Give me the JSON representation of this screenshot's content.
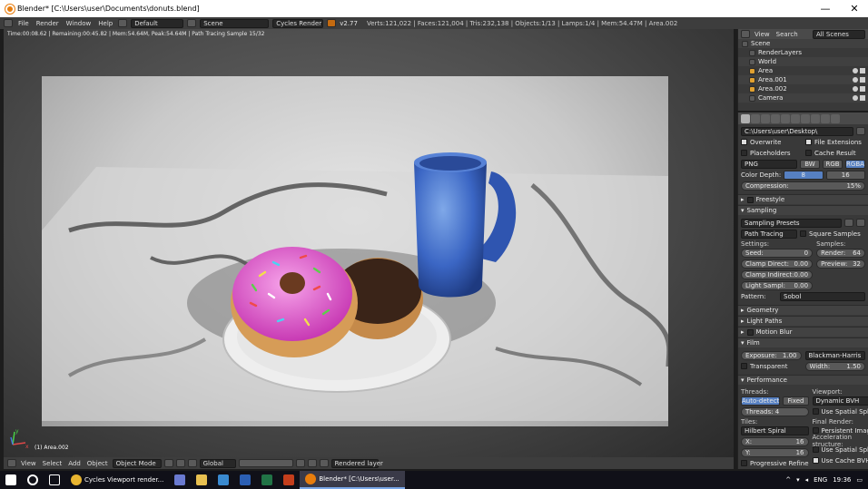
{
  "window": {
    "title": "Blender* [C:\\Users\\user\\Documents\\donuts.blend]",
    "minimize": "—",
    "maximize": "☐",
    "close": "✕"
  },
  "infobar": {
    "menus": [
      "File",
      "Render",
      "Window",
      "Help"
    ],
    "layout": "Default",
    "scene": "Scene",
    "engine": "Cycles Render",
    "version": "v2.77",
    "stats": "Verts:121,022 | Faces:121,004 | Tris:232,138 | Objects:1/13 | Lamps:1/4 | Mem:54.47M | Area.002"
  },
  "viewport": {
    "status": "Time:00:08.62 | Remaining:00:45.82 | Mem:54.64M, Peak:54.64M | Path Tracing Sample 15/32",
    "object_name": "(1) Area.002",
    "axis_x": "x",
    "axis_y": "y",
    "header": {
      "menus": [
        "View",
        "Select",
        "Add",
        "Object"
      ],
      "mode": "Object Mode",
      "pivot": "Global",
      "layer": "Rendered layer"
    }
  },
  "outliner": {
    "view": "View",
    "search": "Search",
    "filter": "All Scenes",
    "items": [
      {
        "label": "Scene",
        "indent": 0
      },
      {
        "label": "RenderLayers",
        "indent": 1
      },
      {
        "label": "World",
        "indent": 1
      },
      {
        "label": "Area",
        "indent": 1
      },
      {
        "label": "Area.001",
        "indent": 1
      },
      {
        "label": "Area.002",
        "indent": 1
      },
      {
        "label": "Camera",
        "indent": 1
      }
    ]
  },
  "properties": {
    "output_path": "C:\\Users\\user\\Desktop\\",
    "overwrite": "Overwrite",
    "file_extensions": "File Extensions",
    "placeholders": "Placeholders",
    "cache_result": "Cache Result",
    "format": "PNG",
    "color_modes": [
      "BW",
      "RGB",
      "RGBA"
    ],
    "color_depth_label": "Color Depth:",
    "color_depth": [
      "8",
      "16"
    ],
    "compression_label": "Compression:",
    "compression": "15%",
    "freestyle": "Freestyle",
    "sampling": "Sampling",
    "sampling_presets": "Sampling Presets",
    "integrator": "Path Tracing",
    "square_samples": "Square Samples",
    "settings_label": "Settings:",
    "samples_label": "Samples:",
    "seed_label": "Seed:",
    "seed": "0",
    "clamp_direct_label": "Clamp Direct:",
    "clamp_direct": "0.00",
    "clamp_indirect_label": "Clamp Indirect:",
    "clamp_indirect": "0.00",
    "light_sampling_label": "Light Sampl:",
    "light_sampling": "0.00",
    "render_label": "Render:",
    "render_samples": "64",
    "preview_label": "Preview:",
    "preview_samples": "32",
    "pattern_label": "Pattern:",
    "pattern": "Sobol",
    "geometry": "Geometry",
    "light_paths": "Light Paths",
    "motion_blur": "Motion Blur",
    "film": "Film",
    "exposure_label": "Exposure:",
    "exposure": "1.00",
    "transparent": "Transparent",
    "filter": "Blackman-Harris",
    "width_label": "Width:",
    "width": "1.50",
    "performance": "Performance",
    "threads_label": "Threads:",
    "threads_modes": [
      "Auto-detect",
      "Fixed"
    ],
    "threads": "Threads: 4",
    "viewport_label": "Viewport:",
    "viewport_bvh": "Dynamic BVH",
    "use_spatial_splits": "Use Spatial Splits",
    "tiles_label": "Tiles:",
    "tile_order": "Hilbert Spiral",
    "tile_x_label": "X:",
    "tile_x": "16",
    "tile_y_label": "Y:",
    "tile_y": "16",
    "final_render_label": "Final Render:",
    "persistent_images": "Persistent Images",
    "acceleration_label": "Acceleration structure:",
    "use_spatial": "Use Spatial Splits",
    "use_cache_bvh": "Use Cache BVH",
    "progressive_refine": "Progressive Refine"
  },
  "taskbar": {
    "apps": [
      {
        "label": "Cycles Viewport render...",
        "active": false
      },
      {
        "label": "Blender* [C:\\Users\\user...",
        "active": true
      }
    ],
    "lang": "ENG",
    "time": "19:36"
  }
}
